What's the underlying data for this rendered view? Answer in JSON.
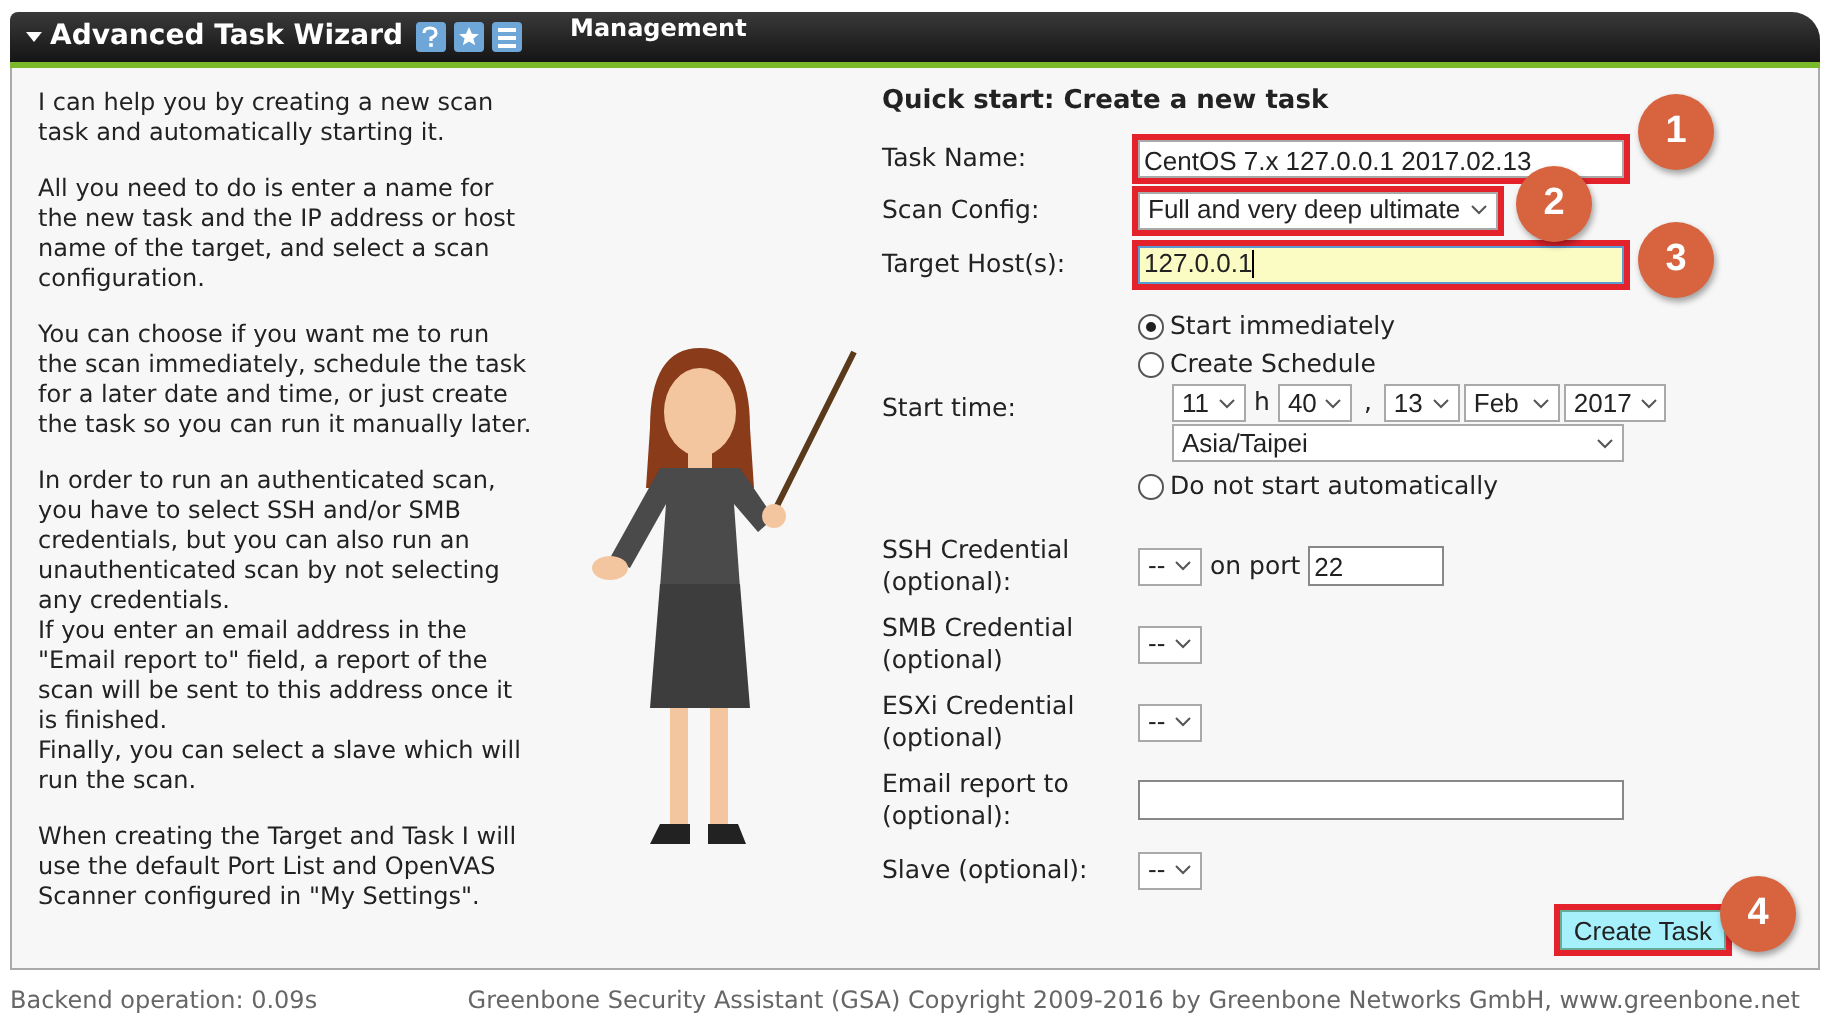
{
  "header": {
    "title": "Advanced Task Wizard",
    "behind_text": "Management"
  },
  "help_text": [
    "I can help you by creating a new scan task and automatically starting it.",
    "All you need to do is enter a name for the new task and the IP address or host name of the target, and select a scan configuration.",
    "You can choose if you want me to run the scan immediately, schedule the task for a later date and time, or just create the task so you can run it manually later.",
    "In order to run an authenticated scan, you have to select SSH and/or SMB credentials, but you can also run an unauthenticated scan by not selecting any credentials.\nIf you enter an email address in the \"Email report to\" field, a report of the scan will be sent to this address once it is finished.\nFinally, you can select a slave which will run the scan.",
    "When creating the Target and Task I will use the default Port List and OpenVAS Scanner configured in \"My Settings\"."
  ],
  "form": {
    "heading": "Quick start: Create a new task",
    "task_name": {
      "label": "Task Name:",
      "value": "CentOS 7.x 127.0.0.1 2017.02.13",
      "highlighted": true,
      "badge": "1"
    },
    "scan_config": {
      "label": "Scan Config:",
      "value": "Full and very deep ultimate",
      "highlighted": true,
      "badge": "2"
    },
    "target_hosts": {
      "label": "Target Host(s):",
      "value": "127.0.0.1",
      "highlighted": true,
      "focused": true,
      "badge": "3"
    },
    "start_time": {
      "label": "Start time:",
      "options": [
        {
          "label": "Start immediately",
          "selected": true
        },
        {
          "label": "Create Schedule",
          "selected": false
        },
        {
          "label": "Do not start automatically",
          "selected": false
        }
      ],
      "hour": "11",
      "hour_unit": "h",
      "minute": "40",
      "separator": ",",
      "day": "13",
      "month": "Feb",
      "year": "2017",
      "timezone": "Asia/Taipei"
    },
    "ssh": {
      "label": "SSH Credential (optional):",
      "value": "--",
      "port_label": "on port",
      "port": "22"
    },
    "smb": {
      "label": "SMB Credential (optional)",
      "value": "--"
    },
    "esxi": {
      "label": "ESXi Credential (optional)",
      "value": "--"
    },
    "email": {
      "label": "Email report to (optional):"
    },
    "slave": {
      "label": "Slave (optional):",
      "value": "--"
    },
    "submit": {
      "label": "Create Task",
      "highlighted": true,
      "badge": "4"
    }
  },
  "footer": {
    "backend": "Backend operation: 0.09s",
    "copyright": "Greenbone Security Assistant (GSA) Copyright 2009-2016 by Greenbone Networks GmbH, www.greenbone.net"
  }
}
